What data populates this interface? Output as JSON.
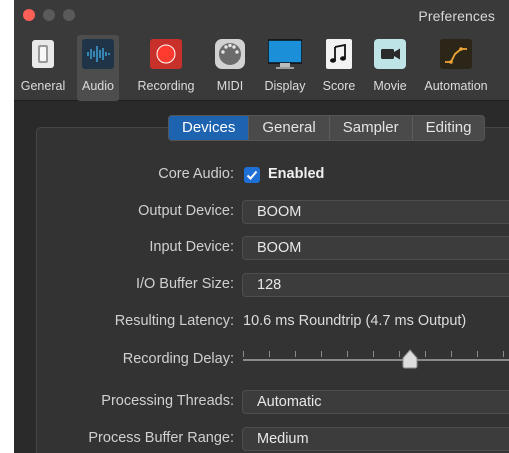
{
  "window": {
    "title": "Preferences"
  },
  "toolbar": {
    "items": [
      {
        "label": "General",
        "icon": "general-switch-icon"
      },
      {
        "label": "Audio",
        "icon": "audio-waveform-icon"
      },
      {
        "label": "Recording",
        "icon": "record-icon"
      },
      {
        "label": "MIDI",
        "icon": "midi-connector-icon"
      },
      {
        "label": "Display",
        "icon": "display-monitor-icon"
      },
      {
        "label": "Score",
        "icon": "music-note-icon"
      },
      {
        "label": "Movie",
        "icon": "movie-camera-icon"
      },
      {
        "label": "Automation",
        "icon": "automation-curve-icon"
      }
    ],
    "active": "Audio"
  },
  "tabs": {
    "items": [
      "Devices",
      "General",
      "Sampler",
      "Editing"
    ],
    "active": "Devices"
  },
  "settings": {
    "core_audio": {
      "label": "Core Audio:",
      "checked": true,
      "value": "Enabled"
    },
    "output_device": {
      "label": "Output Device:",
      "value": "BOOM"
    },
    "input_device": {
      "label": "Input Device:",
      "value": "BOOM"
    },
    "io_buffer": {
      "label": "I/O Buffer Size:",
      "value": "128"
    },
    "latency": {
      "label": "Resulting Latency:",
      "value": "10.6 ms Roundtrip (4.7 ms Output)"
    },
    "recording_delay": {
      "label": "Recording Delay:",
      "level": 0.62
    },
    "threads": {
      "label": "Processing Threads:",
      "value": "Automatic"
    },
    "buffer_range": {
      "label": "Process Buffer Range:",
      "value": "Medium"
    }
  },
  "colors": {
    "accent": "#1e63b0",
    "checkbox": "#1e6fd6",
    "record_red": "#ff3b30",
    "close_red": "#fe5f57"
  }
}
